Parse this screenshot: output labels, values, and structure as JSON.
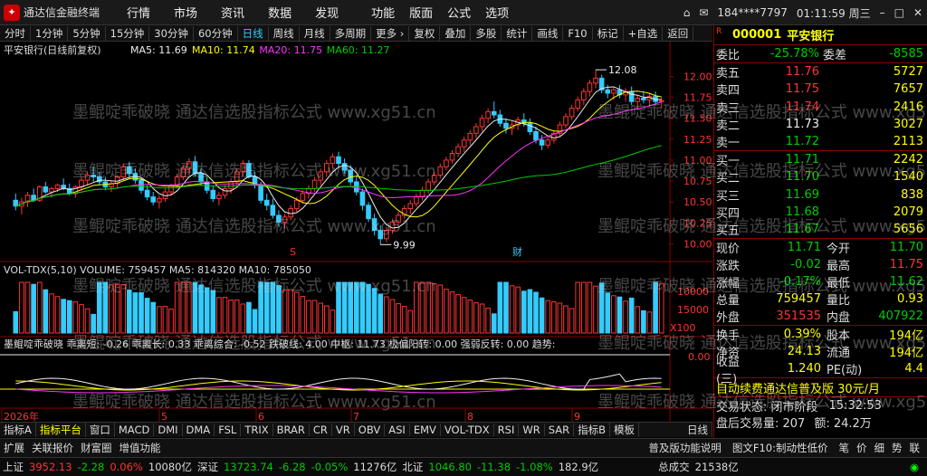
{
  "titlebar": {
    "app_name": "通达信金融终端",
    "menus": [
      "行情",
      "市场",
      "资讯",
      "数据",
      "发现"
    ],
    "menus2": [
      "功能",
      "版面",
      "公式",
      "选项"
    ],
    "user": "184****7797",
    "time": "01:11:59 周三"
  },
  "toolbar": {
    "items": [
      "分时",
      "1分钟",
      "5分钟",
      "15分钟",
      "30分钟",
      "60分钟",
      "日线",
      "周线",
      "月线",
      "多周期",
      "更多",
      "复权",
      "叠加",
      "多股",
      "统计",
      "画线",
      "F10",
      "标记",
      "+自选",
      "返回"
    ],
    "active": "日线"
  },
  "chart": {
    "stock_label": "平安银行(日线前复权)",
    "ma_legend": [
      {
        "text": "MA5: 11.69",
        "color": "#eeeeee"
      },
      {
        "text": "MA10: 11.74",
        "color": "#ffff00"
      },
      {
        "text": "MA20: 11.75",
        "color": "#ff33ff"
      },
      {
        "text": "MA60: 11.27",
        "color": "#00cc00"
      }
    ],
    "high_mark": "12.08",
    "low_mark": "9.99",
    "s_mark": "S",
    "cai_mark": "财",
    "price_axis": [
      "12.00",
      "11.75",
      "11.50",
      "11.25",
      "11.00",
      "10.75",
      "10.50",
      "10.25",
      "10.00"
    ],
    "vol_legend": "VOL-TDX(5,10) VOLUME: 759457 MA5: 814320 MA10: 785050",
    "vol_axis": [
      "10000",
      "15000",
      "X100"
    ],
    "ind_legend": "墨鲲啶乖破晓 乖离短: -0.26 乖离长: 0.33 乖离综合: -0.52 跌破线: 4.00 中枢: 11.73 极偏阳转: 0.00 强弱反转: 0.00 趋势:",
    "ind_axis": [
      "0.00"
    ],
    "date_axis": [
      "2026年",
      "5",
      "6",
      "7",
      "8",
      "9"
    ]
  },
  "watermark": "墨鲲啶乖破晓 通达信选股指标公式 www.xg51.cn",
  "right_panel": {
    "code": "000001",
    "name": "平安银行",
    "weibi_label": "委比",
    "weibi": "-25.78%",
    "weicha_label": "委差",
    "weicha": "-8585",
    "sells": [
      {
        "label": "卖五",
        "price": "11.76",
        "vol": "5727"
      },
      {
        "label": "卖四",
        "price": "11.75",
        "vol": "7657"
      },
      {
        "label": "卖三",
        "price": "11.74",
        "vol": "2416"
      },
      {
        "label": "卖二",
        "price": "11.73",
        "vol": "3027"
      },
      {
        "label": "卖一",
        "price": "11.72",
        "vol": "2113"
      }
    ],
    "buys": [
      {
        "label": "买一",
        "price": "11.71",
        "vol": "2242"
      },
      {
        "label": "买二",
        "price": "11.70",
        "vol": "1540"
      },
      {
        "label": "买三",
        "price": "11.69",
        "vol": "838"
      },
      {
        "label": "买四",
        "price": "11.68",
        "vol": "2079"
      },
      {
        "label": "买五",
        "price": "11.67",
        "vol": "5656"
      }
    ],
    "quote": [
      {
        "a": "现价",
        "b": "11.71",
        "bc": "grn",
        "c": "今开",
        "d": "11.70",
        "dc": "grn"
      },
      {
        "a": "涨跌",
        "b": "-0.02",
        "bc": "grn",
        "c": "最高",
        "d": "11.75",
        "dc": "red"
      },
      {
        "a": "涨幅",
        "b": "-0.17%",
        "bc": "grn",
        "c": "最低",
        "d": "11.62",
        "dc": "grn"
      },
      {
        "a": "总量",
        "b": "759457",
        "bc": "ylw",
        "c": "量比",
        "d": "0.93",
        "dc": "ylw"
      },
      {
        "a": "外盘",
        "b": "351535",
        "bc": "red",
        "c": "内盘",
        "d": "407922",
        "dc": "grn"
      }
    ],
    "fund": [
      {
        "a": "换手",
        "b": "0.39%",
        "c": "股本",
        "d": "194亿"
      },
      {
        "a": "净资",
        "b": "24.13",
        "c": "流通",
        "d": "194亿"
      },
      {
        "a": "收益(三)",
        "b": "1.240",
        "c": "PE(动)",
        "d": "4.4"
      }
    ],
    "promo": "自动续费通达信普及版 30元/月",
    "trade_status": "交易状态: 闭市阶段",
    "trade_time": "15:32:53",
    "after_vol": "盘后交易量: 207",
    "after_amt": "额: 24.2万",
    "mini_tabs": [
      "笔",
      "价",
      "细",
      "势",
      "联"
    ]
  },
  "bottom_tabs": {
    "items": [
      "指标A",
      "指标平台",
      "窗口",
      "MACD",
      "DMI",
      "DMA",
      "FSL",
      "TRIX",
      "BRAR",
      "CR",
      "VR",
      "OBV",
      "ASI",
      "EMV",
      "VOL-TDX",
      "RSI",
      "WR",
      "SAR",
      "指标B",
      "模板"
    ],
    "active": "指标平台",
    "right_label": "日线"
  },
  "bottom2": {
    "items": [
      "扩展",
      "关联报价",
      "财富圈",
      "增值功能"
    ],
    "right_items": [
      "普及版功能说明",
      "图文F10:制动性低价"
    ]
  },
  "statusbar": {
    "sh_label": "上证",
    "sh_val": "3952.13",
    "sh_chg": "-2.28",
    "sh_pct": "0.06%",
    "sh_amt": "10080亿",
    "sz_label": "深证",
    "sz_val": "13723.74",
    "sz_chg": "-6.28",
    "sz_pct": "-0.05%",
    "sz_amt": "11276亿",
    "bz_label": "北证",
    "bz_val": "1046.80",
    "bz_chg": "-11.38",
    "bz_pct": "-1.08%",
    "bz_amt": "182.9亿",
    "total_label": "总成交",
    "total": "21538亿"
  },
  "chart_data": {
    "type": "candlestick",
    "candles": [
      [
        10.52,
        10.6,
        10.4,
        10.45
      ],
      [
        10.45,
        10.55,
        10.35,
        10.5
      ],
      [
        10.5,
        10.62,
        10.44,
        10.58
      ],
      [
        10.58,
        10.66,
        10.5,
        10.52
      ],
      [
        10.52,
        10.7,
        10.5,
        10.68
      ],
      [
        10.68,
        10.74,
        10.6,
        10.62
      ],
      [
        10.62,
        10.68,
        10.55,
        10.66
      ],
      [
        10.66,
        10.72,
        10.62,
        10.7
      ],
      [
        10.7,
        10.78,
        10.64,
        10.66
      ],
      [
        10.66,
        10.72,
        10.58,
        10.6
      ],
      [
        10.6,
        10.7,
        10.55,
        10.68
      ],
      [
        10.68,
        10.8,
        10.64,
        10.76
      ],
      [
        10.76,
        10.86,
        10.7,
        10.82
      ],
      [
        10.82,
        10.92,
        10.74,
        10.8
      ],
      [
        10.8,
        10.86,
        10.7,
        10.74
      ],
      [
        10.74,
        10.8,
        10.64,
        10.68
      ],
      [
        10.68,
        10.76,
        10.62,
        10.72
      ],
      [
        10.72,
        10.82,
        10.66,
        10.8
      ],
      [
        10.8,
        10.96,
        10.76,
        10.92
      ],
      [
        10.92,
        10.98,
        10.8,
        10.84
      ],
      [
        10.84,
        10.9,
        10.72,
        10.76
      ],
      [
        10.76,
        10.8,
        10.6,
        10.64
      ],
      [
        10.64,
        10.7,
        10.52,
        10.56
      ],
      [
        10.56,
        10.62,
        10.46,
        10.5
      ],
      [
        10.5,
        10.58,
        10.42,
        10.54
      ],
      [
        10.54,
        10.66,
        10.5,
        10.62
      ],
      [
        10.62,
        10.72,
        10.58,
        10.7
      ],
      [
        10.7,
        10.84,
        10.66,
        10.8
      ],
      [
        10.8,
        10.94,
        10.76,
        10.9
      ],
      [
        10.9,
        11.02,
        10.84,
        10.98
      ],
      [
        10.98,
        11.05,
        10.8,
        10.84
      ],
      [
        10.84,
        10.9,
        10.7,
        10.74
      ],
      [
        10.74,
        10.8,
        10.6,
        10.64
      ],
      [
        10.64,
        10.7,
        10.5,
        10.54
      ],
      [
        10.54,
        10.62,
        10.46,
        10.58
      ],
      [
        10.58,
        10.7,
        10.54,
        10.66
      ],
      [
        10.66,
        10.78,
        10.6,
        10.74
      ],
      [
        10.74,
        10.9,
        10.7,
        10.86
      ],
      [
        10.86,
        11.0,
        10.8,
        10.96
      ],
      [
        10.96,
        11.0,
        10.78,
        10.8
      ],
      [
        10.8,
        10.86,
        10.66,
        10.7
      ],
      [
        10.7,
        10.74,
        10.48,
        10.52
      ],
      [
        10.52,
        10.6,
        10.4,
        10.46
      ],
      [
        10.46,
        10.54,
        10.3,
        10.34
      ],
      [
        10.34,
        10.4,
        10.2,
        10.26
      ],
      [
        10.26,
        10.36,
        10.18,
        10.32
      ],
      [
        10.32,
        10.46,
        10.28,
        10.42
      ],
      [
        10.42,
        10.56,
        10.38,
        10.52
      ],
      [
        10.52,
        10.64,
        10.48,
        10.6
      ],
      [
        10.6,
        10.7,
        10.54,
        10.66
      ],
      [
        10.66,
        10.8,
        10.62,
        10.76
      ],
      [
        10.76,
        10.9,
        10.7,
        10.86
      ],
      [
        10.86,
        11.0,
        10.8,
        10.96
      ],
      [
        10.96,
        11.08,
        10.9,
        11.04
      ],
      [
        11.04,
        11.1,
        10.92,
        10.96
      ],
      [
        10.96,
        11.02,
        10.84,
        10.88
      ],
      [
        10.88,
        10.94,
        10.7,
        10.74
      ],
      [
        10.74,
        10.8,
        10.58,
        10.62
      ],
      [
        10.62,
        10.66,
        10.4,
        10.46
      ],
      [
        10.46,
        10.5,
        10.26,
        10.3
      ],
      [
        10.3,
        10.36,
        10.1,
        10.16
      ],
      [
        10.16,
        10.22,
        9.99,
        10.06
      ],
      [
        10.06,
        10.2,
        10.02,
        10.16
      ],
      [
        10.16,
        10.3,
        10.12,
        10.26
      ],
      [
        10.26,
        10.38,
        10.22,
        10.34
      ],
      [
        10.34,
        10.46,
        10.3,
        10.42
      ],
      [
        10.42,
        10.52,
        10.36,
        10.48
      ],
      [
        10.48,
        10.6,
        10.44,
        10.56
      ],
      [
        10.56,
        10.68,
        10.52,
        10.64
      ],
      [
        10.64,
        10.78,
        10.6,
        10.74
      ],
      [
        10.74,
        10.86,
        10.7,
        10.82
      ],
      [
        10.82,
        10.96,
        10.78,
        10.92
      ],
      [
        10.92,
        11.04,
        10.88,
        11.0
      ],
      [
        11.0,
        11.12,
        10.96,
        11.08
      ],
      [
        11.08,
        11.2,
        11.04,
        11.16
      ],
      [
        11.16,
        11.28,
        11.1,
        11.24
      ],
      [
        11.24,
        11.36,
        11.18,
        11.32
      ],
      [
        11.32,
        11.44,
        11.26,
        11.4
      ],
      [
        11.4,
        11.54,
        11.34,
        11.5
      ],
      [
        11.5,
        11.62,
        11.44,
        11.58
      ],
      [
        11.58,
        11.7,
        11.5,
        11.54
      ],
      [
        11.54,
        11.6,
        11.4,
        11.44
      ],
      [
        11.44,
        11.5,
        11.32,
        11.38
      ],
      [
        11.38,
        11.46,
        11.3,
        11.42
      ],
      [
        11.42,
        11.52,
        11.36,
        11.48
      ],
      [
        11.48,
        11.56,
        11.4,
        11.44
      ],
      [
        11.44,
        11.5,
        11.3,
        11.34
      ],
      [
        11.34,
        11.4,
        11.2,
        11.24
      ],
      [
        11.24,
        11.3,
        11.12,
        11.18
      ],
      [
        11.18,
        11.28,
        11.14,
        11.24
      ],
      [
        11.24,
        11.36,
        11.2,
        11.32
      ],
      [
        11.32,
        11.46,
        11.28,
        11.42
      ],
      [
        11.42,
        11.56,
        11.38,
        11.52
      ],
      [
        11.52,
        11.66,
        11.48,
        11.62
      ],
      [
        11.62,
        11.76,
        11.58,
        11.72
      ],
      [
        11.72,
        11.86,
        11.66,
        11.82
      ],
      [
        11.82,
        11.96,
        11.76,
        11.92
      ],
      [
        11.92,
        12.08,
        11.86,
        11.98
      ],
      [
        11.98,
        12.02,
        11.8,
        11.84
      ],
      [
        11.84,
        11.9,
        11.74,
        11.8
      ],
      [
        11.8,
        11.88,
        11.72,
        11.84
      ],
      [
        11.84,
        11.9,
        11.74,
        11.78
      ],
      [
        11.78,
        11.86,
        11.7,
        11.82
      ],
      [
        11.82,
        11.88,
        11.66,
        11.7
      ],
      [
        11.7,
        11.78,
        11.62,
        11.74
      ],
      [
        11.74,
        11.82,
        11.68,
        11.72
      ],
      [
        11.72,
        11.8,
        11.64,
        11.76
      ],
      [
        11.76,
        11.82,
        11.66,
        11.7
      ],
      [
        11.7,
        11.75,
        11.62,
        11.71
      ]
    ],
    "y_range": [
      9.95,
      12.2
    ]
  }
}
